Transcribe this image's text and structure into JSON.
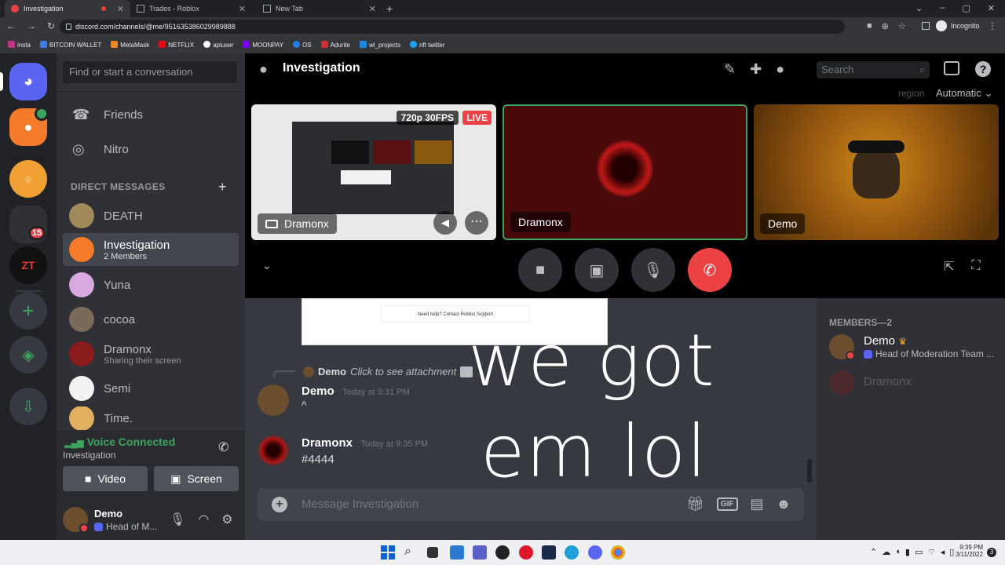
{
  "browser": {
    "tabs": [
      {
        "label": "Investigation"
      },
      {
        "label": "Trades - Roblox"
      },
      {
        "label": "New Tab"
      }
    ],
    "url": "discord.com/channels/@me/951635386029989888",
    "profile": "Incognito",
    "bookmarks": [
      "insta",
      "BITCOIN WALLET",
      "MetaMask",
      "NETFLIX",
      "apiuser",
      "MOONPAY",
      "OS",
      "Adurite",
      "wl_projects",
      "nft twitter"
    ]
  },
  "guilds": {
    "badge": "15"
  },
  "dm_sidebar": {
    "search_placeholder": "Find or start a conversation",
    "friends": "Friends",
    "nitro": "Nitro",
    "header": "DIRECT MESSAGES",
    "items": [
      {
        "name": "DEATH",
        "sub": ""
      },
      {
        "name": "Investigation",
        "sub": "2 Members"
      },
      {
        "name": "Yuna",
        "sub": ""
      },
      {
        "name": "cocoa",
        "sub": ""
      },
      {
        "name": "Dramonx",
        "sub": "Sharing their screen"
      },
      {
        "name": "Semi",
        "sub": ""
      },
      {
        "name": "Time.",
        "sub": ""
      }
    ]
  },
  "voice": {
    "status": "Voice Connected",
    "channel": "Investigation",
    "video": "Video",
    "screen": "Screen"
  },
  "user": {
    "name": "Demo",
    "status": "Head of M..."
  },
  "channel": {
    "title": "Investigation",
    "search_placeholder": "Search",
    "region_label": "region",
    "region_value": "Automatic"
  },
  "tiles": [
    {
      "name": "Dramonx",
      "quality": "720p 30FPS",
      "live": "LIVE"
    },
    {
      "name": "Dramonx"
    },
    {
      "name": "Demo"
    }
  ],
  "messages": {
    "embed_text": "Need help? Contact Roblox Support",
    "reply_name": "Demo",
    "reply_text": "Click to see attachment",
    "list": [
      {
        "author": "Demo",
        "time": "Today at 9:31 PM",
        "text": "^"
      },
      {
        "author": "Dramonx",
        "time": "Today at 9:35 PM",
        "text": "#4444"
      }
    ],
    "input_placeholder": "Message Investigation",
    "gif": "GIF"
  },
  "overlay": {
    "line1": "we got",
    "line2": "em lol"
  },
  "members_panel": {
    "header": "MEMBERS—2",
    "members": [
      {
        "name": "Demo",
        "activity": "Head of Moderation Team ..."
      },
      {
        "name": "Dramonx",
        "activity": ""
      }
    ]
  },
  "taskbar": {
    "time": "9:39 PM",
    "date": "3/11/2022",
    "notif": "3"
  },
  "colors": {
    "blurple": "#5865f2",
    "green": "#3ba55d",
    "red": "#ed4245",
    "bg": "#36393f"
  }
}
